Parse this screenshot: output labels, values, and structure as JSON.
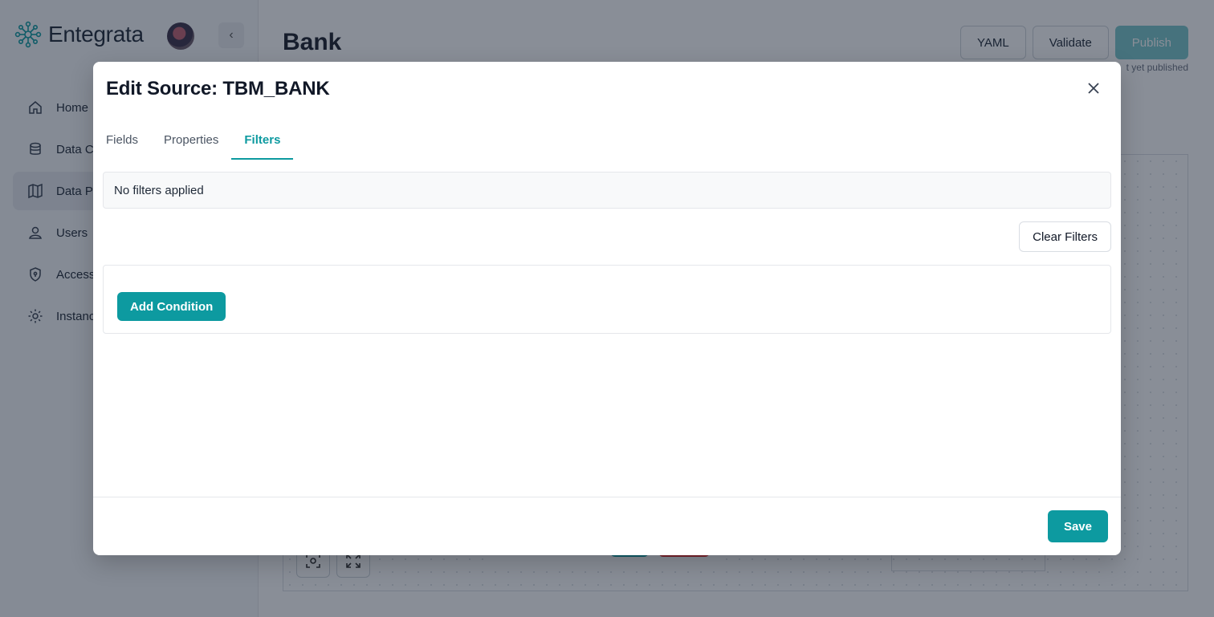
{
  "app": {
    "brand": "Entegrata",
    "collapse_glyph": "‹"
  },
  "sidebar": {
    "items": [
      {
        "label": "Home",
        "icon": "home-icon"
      },
      {
        "label": "Data Co",
        "icon": "database-icon"
      },
      {
        "label": "Data Pi",
        "icon": "map-icon"
      },
      {
        "label": "Users",
        "icon": "user-icon"
      },
      {
        "label": "Access",
        "icon": "shield-icon"
      },
      {
        "label": "Instanc",
        "icon": "gear-icon"
      }
    ]
  },
  "header": {
    "title": "Bank",
    "yaml_label": "YAML",
    "validate_label": "Validate",
    "publish_label": "Publish",
    "publish_status": "t yet published"
  },
  "modal": {
    "title": "Edit Source: TBM_BANK",
    "tabs": [
      {
        "label": "Fields",
        "active": false
      },
      {
        "label": "Properties",
        "active": false
      },
      {
        "label": "Filters",
        "active": true
      }
    ],
    "filters_status": "No filters applied",
    "clear_filters_label": "Clear Filters",
    "add_condition_label": "Add Condition",
    "save_label": "Save"
  },
  "colors": {
    "accent": "#0d9aa0",
    "danger": "#dc2626",
    "overlay": "rgba(20,30,48,0.5)"
  }
}
